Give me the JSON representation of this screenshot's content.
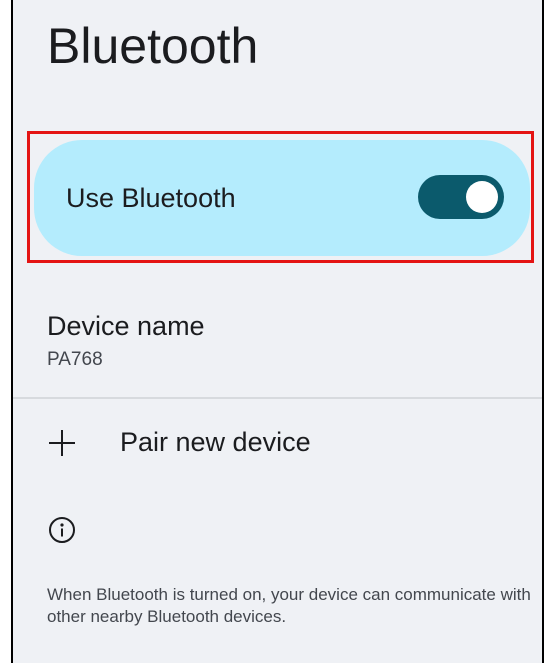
{
  "header": {
    "title": "Bluetooth"
  },
  "bluetooth_toggle": {
    "label": "Use Bluetooth",
    "state": "on",
    "accent_color": "#0b5a6c",
    "card_color": "#b4ecfd",
    "highlight_color": "#e41414"
  },
  "device_name": {
    "title": "Device name",
    "value": "PA768"
  },
  "pair_new_device": {
    "icon": "plus-icon",
    "label": "Pair new device"
  },
  "info": {
    "icon": "info-icon",
    "text": "When Bluetooth is turned on, your device can communicate with other nearby Bluetooth devices."
  }
}
